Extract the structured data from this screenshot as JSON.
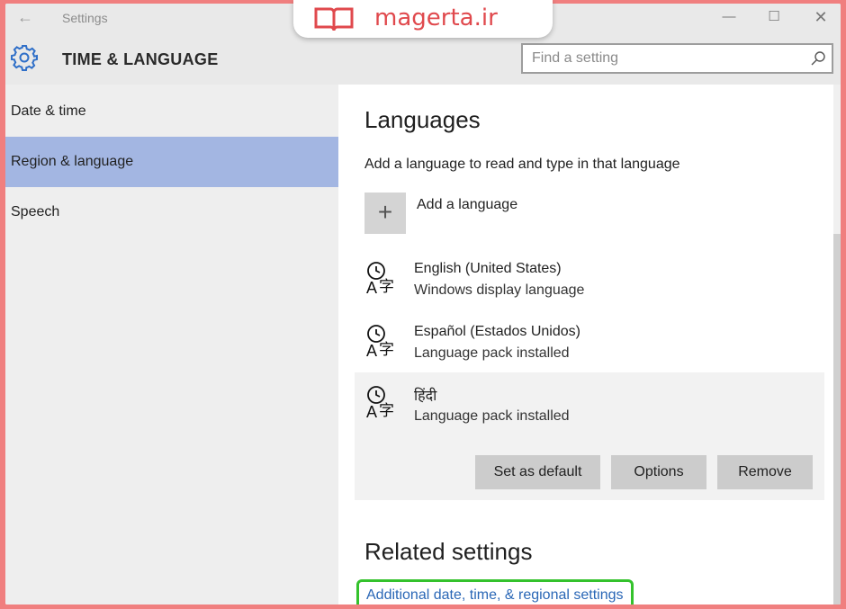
{
  "window": {
    "title": "Settings",
    "back_glyph": "←",
    "minimize_glyph": "—",
    "maximize_glyph": "☐",
    "close_glyph": "✕"
  },
  "header": {
    "section_title": "TIME & LANGUAGE",
    "search_placeholder": "Find a setting",
    "icon": "gear-icon"
  },
  "sidebar": {
    "items": [
      {
        "label": "Date & time",
        "active": false
      },
      {
        "label": "Region & language",
        "active": true
      },
      {
        "label": "Speech",
        "active": false
      }
    ]
  },
  "main": {
    "languages_heading": "Languages",
    "languages_description": "Add a language to read and type in that language",
    "add_language_glyph": "+",
    "add_language_label": "Add a language",
    "languages": [
      {
        "name": "English (United States)",
        "status": "Windows display language",
        "icon": "language-icon"
      },
      {
        "name": "Español (Estados Unidos)",
        "status": "Language pack installed",
        "icon": "language-icon"
      },
      {
        "name": "हिंदी",
        "status": "Language pack installed",
        "icon": "language-icon",
        "selected": true
      }
    ],
    "buttons": {
      "set_default": "Set as default",
      "options": "Options",
      "remove": "Remove"
    },
    "related_heading": "Related settings",
    "related_link": "Additional date, time, & regional settings"
  },
  "watermark": {
    "text": "magerta.ir",
    "color": "#e0494d"
  },
  "colors": {
    "active_nav": "#a3b6e2",
    "link": "#2a67b6",
    "highlight_border": "#34c22c",
    "outer_frame": "#f07f7f"
  }
}
